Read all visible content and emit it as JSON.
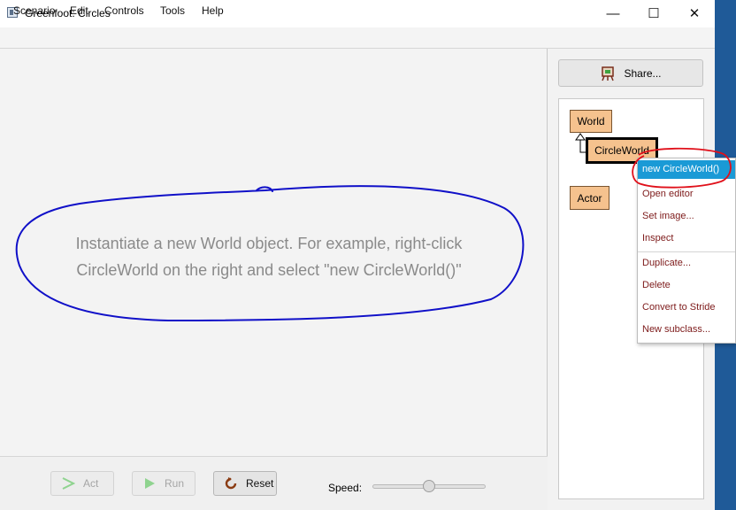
{
  "window": {
    "title": "Greenfoot: Circles",
    "icon": "app-icon",
    "controls": {
      "minimize": "—",
      "maximize": "☐",
      "close": "✕"
    }
  },
  "menu": [
    "Scenario",
    "Edit",
    "Controls",
    "Tools",
    "Help"
  ],
  "world": {
    "hint_line1": "Instantiate a new World object. For example, right-click",
    "hint_line2": "CircleWorld on the right and select \"new CircleWorld()\""
  },
  "controls": {
    "act": "Act",
    "run": "Run",
    "reset": "Reset",
    "speed_label": "Speed:",
    "speed_fraction": 0.5
  },
  "right_panel": {
    "share": "Share...",
    "classes": {
      "world": "World",
      "circleworld": "CircleWorld",
      "actor": "Actor"
    }
  },
  "context_menu": {
    "items": [
      "new CircleWorld()",
      "Open editor",
      "Set image...",
      "Inspect",
      "Duplicate...",
      "Delete",
      "Convert to Stride",
      "New subclass..."
    ],
    "selected_index": 0
  },
  "colors": {
    "class_fill": "#f5c28e",
    "menu_highlight": "#1a9ad6",
    "annotation_blue": "#1010c8",
    "annotation_red": "#e0101a",
    "desktop_blue": "#1f5a98"
  }
}
